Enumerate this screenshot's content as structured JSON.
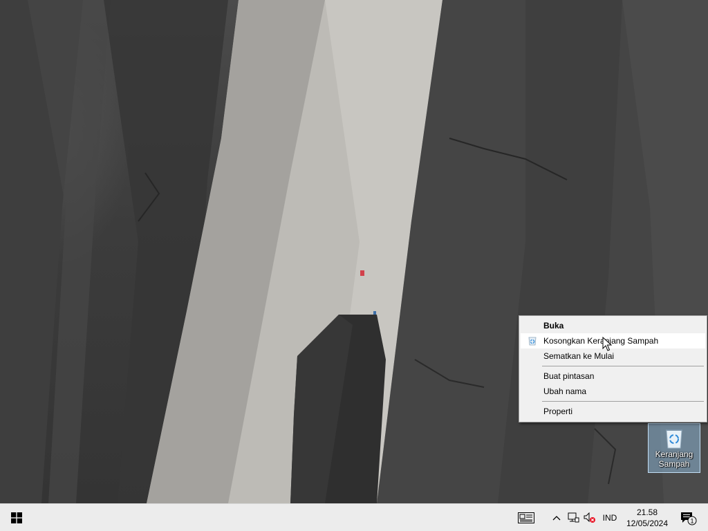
{
  "desktop": {
    "recycle_bin": {
      "label": "Keranjang Sampah",
      "icon": "recycle-bin-icon"
    }
  },
  "context_menu": {
    "items": [
      {
        "label": "Buka",
        "bold": true
      },
      {
        "label": "Kosongkan Keranjang Sampah",
        "icon": "recycle-bin-icon",
        "hovered": true
      },
      {
        "label": "Sematkan ke Mulai"
      },
      {
        "label": "Buat pintasan"
      },
      {
        "label": "Ubah nama"
      },
      {
        "label": "Properti"
      }
    ]
  },
  "taskbar": {
    "start_icon": "windows-logo-icon",
    "task_view_icon": "task-view-icon",
    "tray": {
      "chevron_icon": "chevron-up-icon",
      "network_icon": "network-icon",
      "volume_icon": "volume-muted-icon",
      "language": "IND",
      "time": "21.58",
      "date": "12/05/2024",
      "notification_icon": "notification-icon",
      "notification_count": "1"
    }
  },
  "colors": {
    "menu_bg": "#f0f0f0",
    "menu_hover": "#ffffff",
    "taskbar_bg": "#ececec",
    "selection": "#99c9ef"
  }
}
